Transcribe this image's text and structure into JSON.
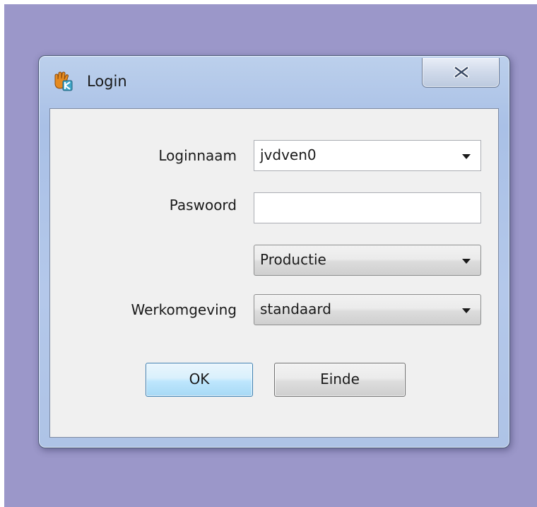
{
  "window": {
    "title": "Login",
    "icon": "app-hand-k-icon",
    "close_icon": "close-icon"
  },
  "form": {
    "loginnaam_label": "Loginnaam",
    "loginnaam_value": "jvdven0",
    "paswoord_label": "Paswoord",
    "paswoord_value": "",
    "omgeving_value": "Productie",
    "werkomgeving_label": "Werkomgeving",
    "werkomgeving_value": "standaard"
  },
  "buttons": {
    "ok_label": "OK",
    "einde_label": "Einde"
  },
  "colors": {
    "desktop": "#9b97c9",
    "accent_ok": "#3c7fb1"
  }
}
